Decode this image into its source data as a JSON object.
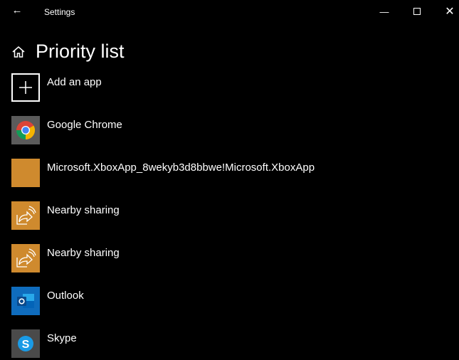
{
  "window": {
    "title": "Settings",
    "back_icon": "arrow-left",
    "minimize": "minimize-icon",
    "maximize": "maximize-icon",
    "close": "close-icon"
  },
  "page": {
    "title": "Priority list",
    "home_icon": "home-icon"
  },
  "add_app": {
    "label": "Add an app",
    "icon": "plus-icon"
  },
  "apps": [
    {
      "name": "Google Chrome",
      "icon": "chrome-icon",
      "color": "#5b5b5b"
    },
    {
      "name": "Microsoft.XboxApp_8wekyb3d8bbwe!Microsoft.XboxApp",
      "icon": "blank-app-icon",
      "color": "#cf8a2e"
    },
    {
      "name": "Nearby sharing",
      "icon": "nearby-sharing-icon",
      "color": "#cf8a2e"
    },
    {
      "name": "Nearby sharing",
      "icon": "nearby-sharing-icon",
      "color": "#cf8a2e"
    },
    {
      "name": "Outlook",
      "icon": "outlook-icon",
      "color": "#0f6cbd"
    },
    {
      "name": "Skype",
      "icon": "skype-icon",
      "color": "#4a4a4a"
    }
  ]
}
